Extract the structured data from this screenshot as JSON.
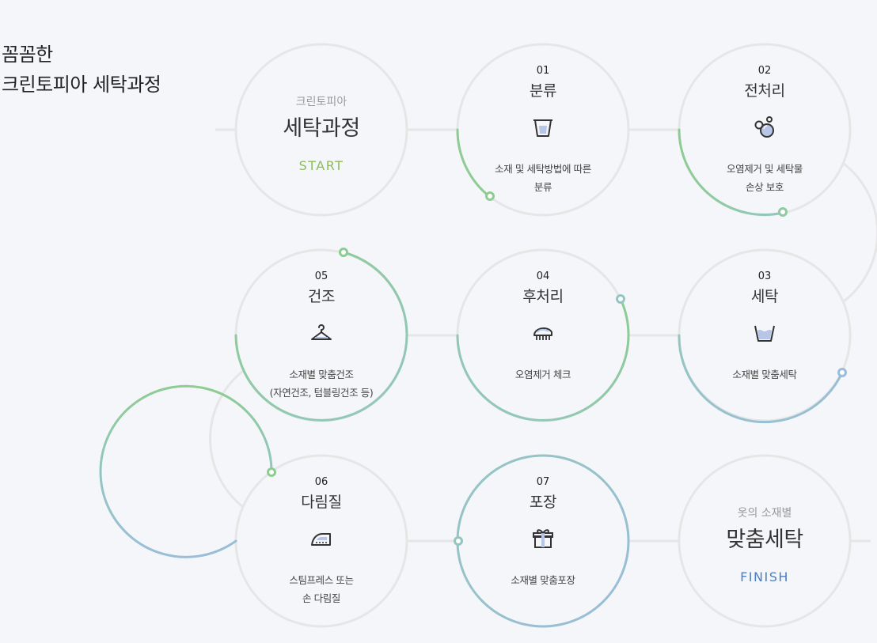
{
  "heading": {
    "line1": "꼼꼼한",
    "line2": "크린토피아 세탁과정"
  },
  "start": {
    "sub": "크린토피아",
    "big": "세탁과정",
    "tag": "START",
    "tag_color": "#8bbd5a"
  },
  "finish": {
    "sub": "옷의 소재별",
    "big": "맞춤세탁",
    "tag": "FINISH",
    "tag_color": "#4a7fc1"
  },
  "steps": [
    {
      "num": "01",
      "title": "분류",
      "desc1": "소재 및 세탁방법에 따른",
      "desc2": "분류",
      "icon": "bucket-icon"
    },
    {
      "num": "02",
      "title": "전처리",
      "desc1": "오염제거 및 세탁물",
      "desc2": "손상 보호",
      "icon": "bubbles-icon"
    },
    {
      "num": "03",
      "title": "세탁",
      "desc1": "소재별 맞춤세탁",
      "desc2": "",
      "icon": "wash-basin-icon"
    },
    {
      "num": "04",
      "title": "후처리",
      "desc1": "오염제거 체크",
      "desc2": "",
      "icon": "brush-icon"
    },
    {
      "num": "05",
      "title": "건조",
      "desc1": "소재별 맞춤건조",
      "desc2": "(자연건조, 텀블링건조 등)",
      "icon": "hanger-icon"
    },
    {
      "num": "06",
      "title": "다림질",
      "desc1": "스팀프레스 또는",
      "desc2": "손 다림질",
      "icon": "iron-icon"
    },
    {
      "num": "07",
      "title": "포장",
      "desc1": "소재별 맞춤포장",
      "desc2": "",
      "icon": "gift-icon"
    }
  ],
  "colors": {
    "green": "#8dcc92",
    "teal": "#93c6c0",
    "blue": "#9abdd9",
    "track": "#e6e6e6"
  }
}
